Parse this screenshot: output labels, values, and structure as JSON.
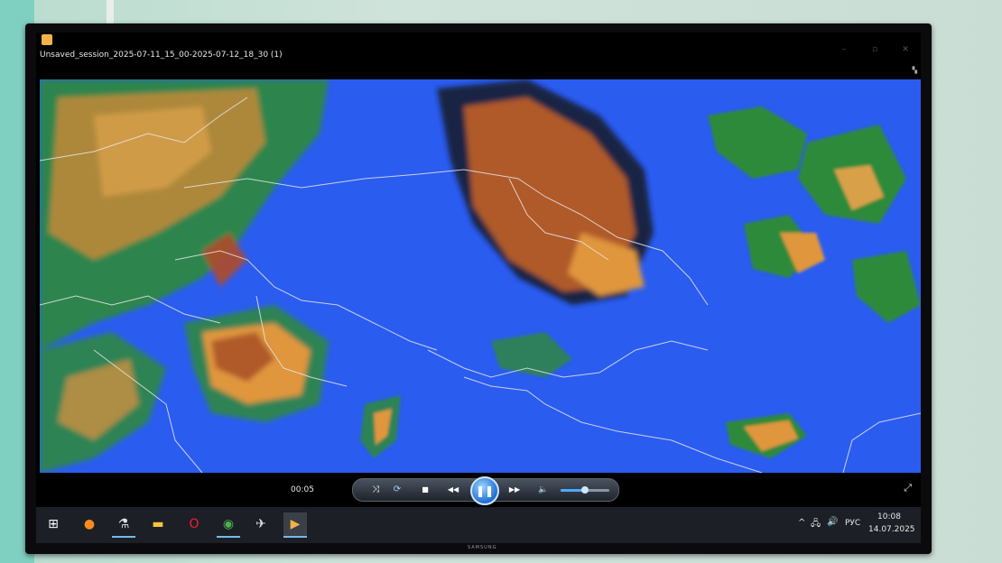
{
  "window": {
    "title": "Unsaved_session_2025-07-11_15_00-2025-07-12_18_30 (1)",
    "minimize_glyph": "–",
    "maximize_glyph": "▫",
    "close_glyph": "✕"
  },
  "player": {
    "elapsed": "00:05",
    "volume_level": 0.5,
    "buttons": {
      "shuffle": "⤨",
      "repeat": "⟳",
      "stop": "■",
      "previous": "◀◀",
      "play_pause": "❚❚",
      "next": "▶▶",
      "mute": "🔈",
      "fullscreen": "⤢"
    }
  },
  "monitor": {
    "brand": "SAMSUNG"
  },
  "taskbar": {
    "items": [
      {
        "name": "start",
        "glyph": "⊞",
        "color": "#ffffff"
      },
      {
        "name": "firefox",
        "glyph": "●",
        "color": "#ff8a1f"
      },
      {
        "name": "satellite-app",
        "glyph": "⚗",
        "color": "#e0e0e0"
      },
      {
        "name": "file-explorer",
        "glyph": "▬",
        "color": "#f6c342"
      },
      {
        "name": "opera",
        "glyph": "O",
        "color": "#ff1b2d"
      },
      {
        "name": "chrome",
        "glyph": "◉",
        "color": "#4caf50"
      },
      {
        "name": "app-plane",
        "glyph": "✈",
        "color": "#e0e0e0"
      },
      {
        "name": "media-player",
        "glyph": "▶",
        "color": "#f2b24a"
      }
    ]
  },
  "tray": {
    "chevron": "^",
    "network_glyph": "🖧",
    "sound_glyph": "🔊",
    "language": "РУС",
    "time": "10:08",
    "date": "14.07.2025"
  },
  "colors": {
    "ocean": "#2a5cf0",
    "cloud_high": "#b05a2c",
    "cloud_mid": "#e0963c",
    "cloud_low": "#2f8a3a",
    "border_lines": "#e6e6e6"
  }
}
